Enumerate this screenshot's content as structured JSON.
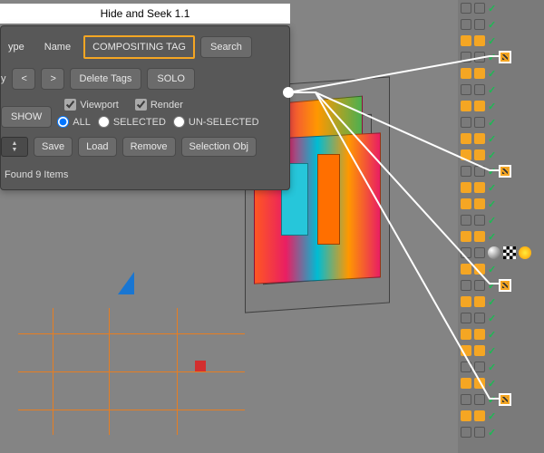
{
  "panel": {
    "title": "Hide and Seek 1.1",
    "tabs": {
      "type": "ype",
      "name": "Name",
      "compositing": "COMPOSITING TAG"
    },
    "search": "Search",
    "history_label": "y",
    "prev": "<",
    "next": ">",
    "delete_tags": "Delete Tags",
    "solo": "SOLO",
    "show": "SHOW",
    "viewport_check": "Viewport",
    "render_check": "Render",
    "scope": {
      "all": "ALL",
      "selected": "SELECTED",
      "unselected": "UN-SELECTED"
    },
    "save": "Save",
    "load": "Load",
    "remove": "Remove",
    "selection_obj": "Selection Obj",
    "status": "Found 9 Items"
  },
  "objmgr": {
    "rows": 27
  }
}
